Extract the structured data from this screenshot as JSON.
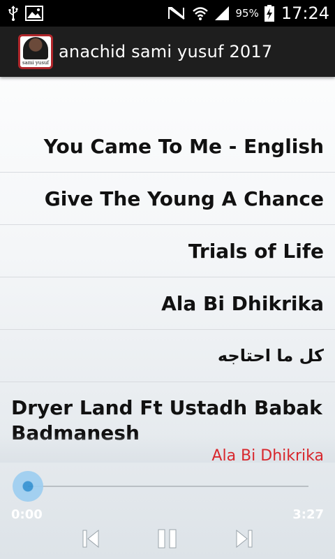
{
  "status_bar": {
    "battery_percent": "95%",
    "time": "17:24",
    "icons": [
      "usb-icon",
      "image-icon",
      "mute-icon",
      "wifi-icon",
      "signal-icon",
      "battery-charging-icon"
    ]
  },
  "app": {
    "title": "anachid sami yusuf 2017",
    "icon_caption": "sami yusuf"
  },
  "tracks": [
    {
      "label": "You Came To Me - English"
    },
    {
      "label": "Give The Young A Chance"
    },
    {
      "label": "Trials of Life"
    },
    {
      "label": "Ala Bi Dhikrika"
    },
    {
      "label": "كل ما احتاجه"
    }
  ],
  "current_track_title": "Dryer Land Ft Ustadh Babak Badmanesh",
  "player": {
    "now_playing": "Ala Bi Dhikrika",
    "elapsed": "0:00",
    "total": "3:27",
    "progress": 0.0,
    "accent_color": "#d8272d",
    "seek_color": "#2f8fd2",
    "controls": [
      "previous-icon",
      "pause-icon",
      "next-icon"
    ]
  }
}
